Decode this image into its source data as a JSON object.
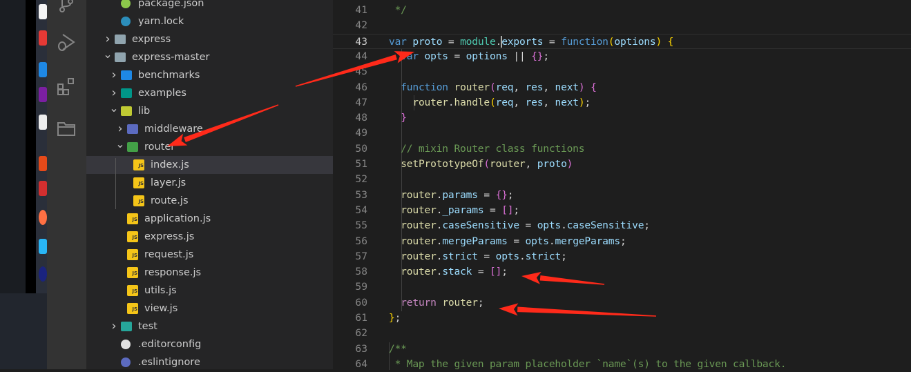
{
  "explorer": {
    "items": [
      {
        "label": "package.json",
        "depth": 1,
        "type": "file",
        "icon": "nodejs-icon",
        "color": "#8cc84b"
      },
      {
        "label": "yarn.lock",
        "depth": 1,
        "type": "file",
        "icon": "yarn-icon",
        "color": "#2c8ebb"
      },
      {
        "label": "express",
        "depth": 0,
        "type": "folder",
        "expanded": false,
        "icon": "folder-icon",
        "color": "#90a4ae"
      },
      {
        "label": "express-master",
        "depth": 0,
        "type": "folder",
        "expanded": true,
        "icon": "folder-open-icon",
        "color": "#90a4ae"
      },
      {
        "label": "benchmarks",
        "depth": 1,
        "type": "folder",
        "expanded": false,
        "icon": "folder-benchmark-icon",
        "color": "#1e88e5"
      },
      {
        "label": "examples",
        "depth": 1,
        "type": "folder",
        "expanded": false,
        "icon": "folder-examples-icon",
        "color": "#009688"
      },
      {
        "label": "lib",
        "depth": 1,
        "type": "folder",
        "expanded": true,
        "icon": "folder-lib-icon",
        "color": "#c0ca33"
      },
      {
        "label": "middleware",
        "depth": 2,
        "type": "folder",
        "expanded": false,
        "icon": "folder-middleware-icon",
        "color": "#5c6bc0"
      },
      {
        "label": "router",
        "depth": 2,
        "type": "folder",
        "expanded": true,
        "icon": "folder-router-icon",
        "color": "#43a047"
      },
      {
        "label": "index.js",
        "depth": 3,
        "type": "js",
        "selected": true
      },
      {
        "label": "layer.js",
        "depth": 3,
        "type": "js"
      },
      {
        "label": "route.js",
        "depth": 3,
        "type": "js"
      },
      {
        "label": "application.js",
        "depth": 2,
        "type": "js"
      },
      {
        "label": "express.js",
        "depth": 2,
        "type": "js"
      },
      {
        "label": "request.js",
        "depth": 2,
        "type": "js"
      },
      {
        "label": "response.js",
        "depth": 2,
        "type": "js"
      },
      {
        "label": "utils.js",
        "depth": 2,
        "type": "js"
      },
      {
        "label": "view.js",
        "depth": 2,
        "type": "js"
      },
      {
        "label": "test",
        "depth": 1,
        "type": "folder",
        "expanded": false,
        "icon": "folder-test-icon",
        "color": "#26a69a"
      },
      {
        "label": ".editorconfig",
        "depth": 1,
        "type": "file",
        "icon": "editorconfig-icon",
        "color": "#e0e0e0"
      },
      {
        "label": ".eslintignore",
        "depth": 1,
        "type": "file",
        "icon": "eslint-icon",
        "color": "#5c6bc0"
      }
    ],
    "js_badge": "JS"
  },
  "activity_bar": [
    "source-control-icon",
    "run-debug-icon",
    "extensions-icon",
    "explorer-icon"
  ],
  "editor": {
    "current_line": 43,
    "lines": [
      {
        "n": 41,
        "t": [
          [
            " */",
            "cm"
          ]
        ]
      },
      {
        "n": 42,
        "t": []
      },
      {
        "n": 43,
        "t": [
          [
            "var",
            "kw"
          ],
          [
            " ",
            "p"
          ],
          [
            "proto",
            "var"
          ],
          [
            " = ",
            "p"
          ],
          [
            "module",
            "mod"
          ],
          [
            ".",
            "p"
          ],
          [
            "exports",
            "var"
          ],
          [
            " = ",
            "p"
          ],
          [
            "function",
            "kw"
          ],
          [
            "(",
            "b1"
          ],
          [
            "options",
            "var"
          ],
          [
            ")",
            "b1"
          ],
          [
            " ",
            "p"
          ],
          [
            "{",
            "b1"
          ]
        ]
      },
      {
        "n": 44,
        "t": [
          [
            "  ",
            "p"
          ],
          [
            "var",
            "kw"
          ],
          [
            " ",
            "p"
          ],
          [
            "opts",
            "var"
          ],
          [
            " = ",
            "p"
          ],
          [
            "options",
            "var"
          ],
          [
            " || ",
            "p"
          ],
          [
            "{}",
            "b2"
          ],
          [
            ";",
            "p"
          ]
        ]
      },
      {
        "n": 45,
        "t": []
      },
      {
        "n": 46,
        "t": [
          [
            "  ",
            "p"
          ],
          [
            "function",
            "kw"
          ],
          [
            " ",
            "p"
          ],
          [
            "router",
            "fn"
          ],
          [
            "(",
            "b2"
          ],
          [
            "req",
            "var"
          ],
          [
            ", ",
            "p"
          ],
          [
            "res",
            "var"
          ],
          [
            ", ",
            "p"
          ],
          [
            "next",
            "var"
          ],
          [
            ")",
            "b2"
          ],
          [
            " ",
            "p"
          ],
          [
            "{",
            "b2"
          ]
        ]
      },
      {
        "n": 47,
        "t": [
          [
            "    ",
            "p"
          ],
          [
            "router",
            "fn"
          ],
          [
            ".",
            "p"
          ],
          [
            "handle",
            "fn"
          ],
          [
            "(",
            "b1"
          ],
          [
            "req",
            "var"
          ],
          [
            ", ",
            "p"
          ],
          [
            "res",
            "var"
          ],
          [
            ", ",
            "p"
          ],
          [
            "next",
            "var"
          ],
          [
            ")",
            "b1"
          ],
          [
            ";",
            "p"
          ]
        ]
      },
      {
        "n": 48,
        "t": [
          [
            "  ",
            "p"
          ],
          [
            "}",
            "b2"
          ]
        ]
      },
      {
        "n": 49,
        "t": []
      },
      {
        "n": 50,
        "t": [
          [
            "  // mixin Router class functions",
            "cm"
          ]
        ]
      },
      {
        "n": 51,
        "t": [
          [
            "  ",
            "p"
          ],
          [
            "setPrototypeOf",
            "fn"
          ],
          [
            "(",
            "b2"
          ],
          [
            "router",
            "fn"
          ],
          [
            ", ",
            "p"
          ],
          [
            "proto",
            "var"
          ],
          [
            ")",
            "b2"
          ]
        ]
      },
      {
        "n": 52,
        "t": []
      },
      {
        "n": 53,
        "t": [
          [
            "  ",
            "p"
          ],
          [
            "router",
            "fn"
          ],
          [
            ".",
            "p"
          ],
          [
            "params",
            "var"
          ],
          [
            " = ",
            "p"
          ],
          [
            "{}",
            "b2"
          ],
          [
            ";",
            "p"
          ]
        ]
      },
      {
        "n": 54,
        "t": [
          [
            "  ",
            "p"
          ],
          [
            "router",
            "fn"
          ],
          [
            ".",
            "p"
          ],
          [
            "_params",
            "var"
          ],
          [
            " = ",
            "p"
          ],
          [
            "[]",
            "b2"
          ],
          [
            ";",
            "p"
          ]
        ]
      },
      {
        "n": 55,
        "t": [
          [
            "  ",
            "p"
          ],
          [
            "router",
            "fn"
          ],
          [
            ".",
            "p"
          ],
          [
            "caseSensitive",
            "var"
          ],
          [
            " = ",
            "p"
          ],
          [
            "opts",
            "var"
          ],
          [
            ".",
            "p"
          ],
          [
            "caseSensitive",
            "var"
          ],
          [
            ";",
            "p"
          ]
        ]
      },
      {
        "n": 56,
        "t": [
          [
            "  ",
            "p"
          ],
          [
            "router",
            "fn"
          ],
          [
            ".",
            "p"
          ],
          [
            "mergeParams",
            "var"
          ],
          [
            " = ",
            "p"
          ],
          [
            "opts",
            "var"
          ],
          [
            ".",
            "p"
          ],
          [
            "mergeParams",
            "var"
          ],
          [
            ";",
            "p"
          ]
        ]
      },
      {
        "n": 57,
        "t": [
          [
            "  ",
            "p"
          ],
          [
            "router",
            "fn"
          ],
          [
            ".",
            "p"
          ],
          [
            "strict",
            "var"
          ],
          [
            " = ",
            "p"
          ],
          [
            "opts",
            "var"
          ],
          [
            ".",
            "p"
          ],
          [
            "strict",
            "var"
          ],
          [
            ";",
            "p"
          ]
        ]
      },
      {
        "n": 58,
        "t": [
          [
            "  ",
            "p"
          ],
          [
            "router",
            "fn"
          ],
          [
            ".",
            "p"
          ],
          [
            "stack",
            "var"
          ],
          [
            " = ",
            "p"
          ],
          [
            "[]",
            "b2"
          ],
          [
            ";",
            "p"
          ]
        ]
      },
      {
        "n": 59,
        "t": []
      },
      {
        "n": 60,
        "t": [
          [
            "  ",
            "p"
          ],
          [
            "return",
            "ret"
          ],
          [
            " ",
            "p"
          ],
          [
            "router",
            "fn"
          ],
          [
            ";",
            "p"
          ]
        ]
      },
      {
        "n": 61,
        "t": [
          [
            "}",
            "b1"
          ],
          [
            ";",
            "p"
          ]
        ]
      },
      {
        "n": 62,
        "t": []
      },
      {
        "n": 63,
        "t": [
          [
            "/**",
            "cm"
          ]
        ]
      },
      {
        "n": 64,
        "t": [
          [
            " * Map the given param placeholder `name`(s) to the given callback.",
            "cm"
          ]
        ]
      }
    ]
  },
  "annotation_color": "#ff2a1a"
}
